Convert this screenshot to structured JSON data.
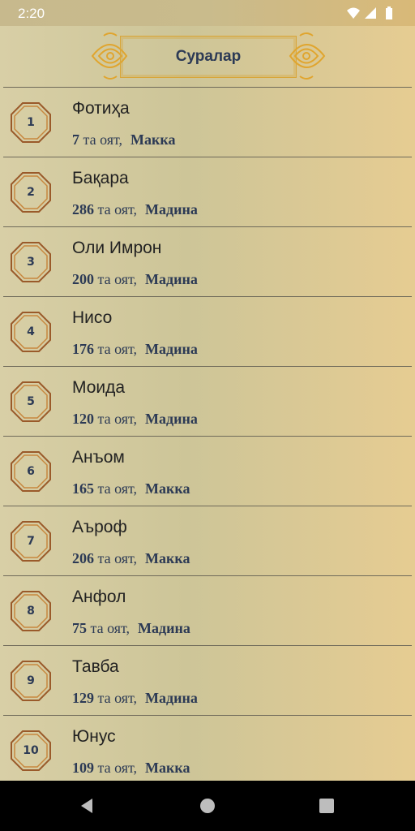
{
  "status_bar": {
    "time": "2:20"
  },
  "header": {
    "title": "Суралар"
  },
  "suras": [
    {
      "number": "1",
      "name": "Фотиҳа",
      "ayah_count": "7",
      "ayah_label": "та оят,",
      "place": "Макка"
    },
    {
      "number": "2",
      "name": "Бақара",
      "ayah_count": "286",
      "ayah_label": "та оят,",
      "place": "Мадина"
    },
    {
      "number": "3",
      "name": "Оли Имрон",
      "ayah_count": "200",
      "ayah_label": "та оят,",
      "place": "Мадина"
    },
    {
      "number": "4",
      "name": "Нисо",
      "ayah_count": "176",
      "ayah_label": "та оят,",
      "place": "Мадина"
    },
    {
      "number": "5",
      "name": "Моида",
      "ayah_count": "120",
      "ayah_label": "та оят,",
      "place": "Мадина"
    },
    {
      "number": "6",
      "name": "Анъом",
      "ayah_count": "165",
      "ayah_label": "та оят,",
      "place": "Макка"
    },
    {
      "number": "7",
      "name": "Аъроф",
      "ayah_count": "206",
      "ayah_label": "та оят,",
      "place": "Макка"
    },
    {
      "number": "8",
      "name": "Анфол",
      "ayah_count": "75",
      "ayah_label": "та оят,",
      "place": "Мадина"
    },
    {
      "number": "9",
      "name": "Тавба",
      "ayah_count": "129",
      "ayah_label": "та оят,",
      "place": "Мадина"
    },
    {
      "number": "10",
      "name": "Юнус",
      "ayah_count": "109",
      "ayah_label": "та оят,",
      "place": "Макка"
    }
  ],
  "icons": {
    "wifi": "wifi-icon",
    "signal": "signal-icon",
    "battery": "battery-icon",
    "back": "back-icon",
    "home": "home-icon",
    "recents": "recents-icon"
  },
  "colors": {
    "accent": "#d8a63a",
    "text_dark": "#2c3a55",
    "badge_brown": "#9a5a2a"
  }
}
